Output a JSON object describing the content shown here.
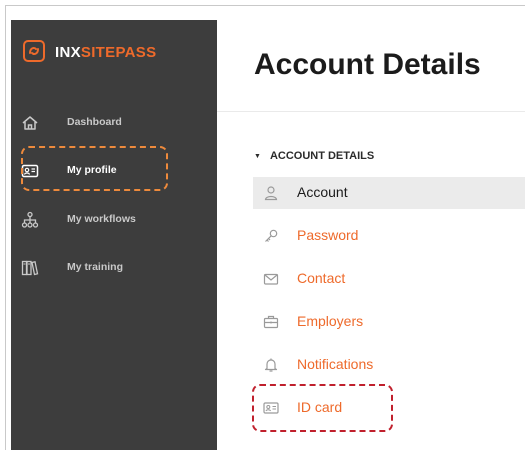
{
  "brand": {
    "logo_text_primary": "INX",
    "logo_text_accent": "SITEPASS",
    "logo_icon": "inx-swirl-logo-icon",
    "accent_color": "#ee6a2b"
  },
  "sidebar": {
    "background_color": "#3d3d3d",
    "items": [
      {
        "label": "Dashboard",
        "icon": "home-icon",
        "active": false
      },
      {
        "label": "My profile",
        "icon": "id-card-icon",
        "active": true
      },
      {
        "label": "My workflows",
        "icon": "hierarchy-icon",
        "active": false
      },
      {
        "label": "My training",
        "icon": "books-icon",
        "active": false
      }
    ]
  },
  "page": {
    "title": "Account Details"
  },
  "account_menu": {
    "section_label": "ACCOUNT DETAILS",
    "items": [
      {
        "label": "Account",
        "icon": "user-icon",
        "selected": true
      },
      {
        "label": "Password",
        "icon": "key-icon",
        "selected": false
      },
      {
        "label": "Contact",
        "icon": "envelope-icon",
        "selected": false
      },
      {
        "label": "Employers",
        "icon": "briefcase-icon",
        "selected": false
      },
      {
        "label": "Notifications",
        "icon": "bell-icon",
        "selected": false
      },
      {
        "label": "ID card",
        "icon": "id-card-icon",
        "selected": false
      }
    ]
  },
  "annotations": {
    "orange_highlight_color": "#ee8a3c",
    "red_highlight_color": "#c0202d"
  }
}
